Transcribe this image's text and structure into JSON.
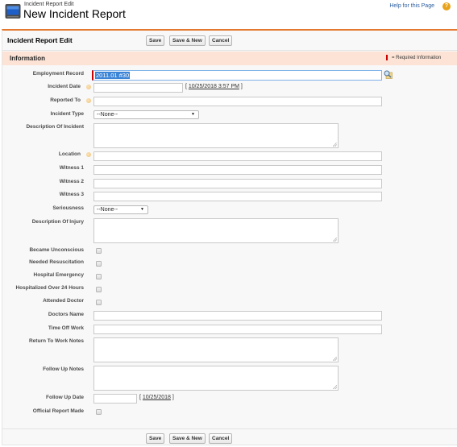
{
  "header": {
    "subtitle": "Incident Report Edit",
    "title": "New Incident Report",
    "help_link": "Help for this Page",
    "help_icon": "?"
  },
  "panel": {
    "title": "Incident Report Edit",
    "buttons": {
      "save": "Save",
      "save_new": "Save & New",
      "cancel": "Cancel"
    }
  },
  "section": {
    "title": "Information",
    "required_legend": "= Required Information"
  },
  "fields": {
    "employment_record": {
      "label": "Employment Record",
      "value": "2011.01 #30",
      "required": true
    },
    "incident_date": {
      "label": "Incident Date",
      "value": "",
      "date_link": "10/25/2018 3:57 PM"
    },
    "reported_to": {
      "label": "Reported To",
      "value": ""
    },
    "incident_type": {
      "label": "Incident Type",
      "selected": "--None--"
    },
    "description_of_incident": {
      "label": "Description Of Incident",
      "value": ""
    },
    "location": {
      "label": "Location",
      "value": ""
    },
    "witness_1": {
      "label": "Witness 1",
      "value": ""
    },
    "witness_2": {
      "label": "Witness 2",
      "value": ""
    },
    "witness_3": {
      "label": "Witness 3",
      "value": ""
    },
    "seriousness": {
      "label": "Seriousness",
      "selected": "--None--"
    },
    "description_of_injury": {
      "label": "Description Of Injury",
      "value": ""
    },
    "became_unconscious": {
      "label": "Became Unconscious",
      "checked": false
    },
    "needed_resuscitation": {
      "label": "Needed Resuscitation",
      "checked": false
    },
    "hospital_emergency": {
      "label": "Hospital Emergency",
      "checked": false
    },
    "hospitalized_over_24": {
      "label": "Hospitalized Over 24 Hours",
      "checked": false
    },
    "attended_doctor": {
      "label": "Attended Doctor",
      "checked": false
    },
    "doctors_name": {
      "label": "Doctors Name",
      "value": ""
    },
    "time_off_work": {
      "label": "Time Off Work",
      "value": ""
    },
    "return_to_work_notes": {
      "label": "Return To Work Notes",
      "value": ""
    },
    "follow_up_notes": {
      "label": "Follow Up Notes",
      "value": ""
    },
    "follow_up_date": {
      "label": "Follow Up Date",
      "value": "",
      "date_link": "10/25/2018"
    },
    "official_report_made": {
      "label": "Official Report Made",
      "checked": false
    }
  },
  "colors": {
    "accent": "#e5782f",
    "section_bg": "#fde3d5",
    "required": "#cc0000",
    "link": "#2a5d9e"
  }
}
